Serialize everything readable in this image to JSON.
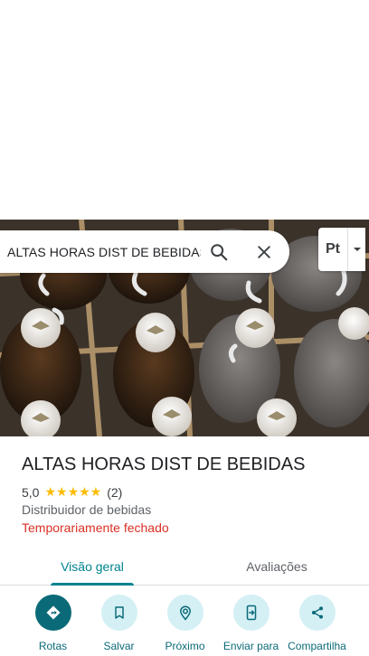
{
  "search": {
    "query": "ALTAS HORAS DIST DE BEBIDAS"
  },
  "translate": {
    "label": "Pt"
  },
  "place": {
    "title": "ALTAS HORAS DIST DE BEBIDAS",
    "rating": "5,0",
    "stars": "★★★★★",
    "review_count": "(2)",
    "category": "Distribuidor de bebidas",
    "status": "Temporariamente fechado"
  },
  "tabs": [
    {
      "label": "Visão geral",
      "active": true
    },
    {
      "label": "Avaliações",
      "active": false
    }
  ],
  "actions": [
    {
      "label": "Rotas",
      "icon": "directions-icon"
    },
    {
      "label": "Salvar",
      "icon": "bookmark-icon"
    },
    {
      "label": "Próximo",
      "icon": "nearby-icon"
    },
    {
      "label": "Enviar para",
      "icon": "send-to-phone-icon"
    },
    {
      "label": "Compartilha",
      "icon": "share-icon"
    }
  ],
  "colors": {
    "accent": "#0b6a78",
    "tab_active": "#00838f",
    "closed": "#d93025",
    "star": "#fbbc04"
  }
}
